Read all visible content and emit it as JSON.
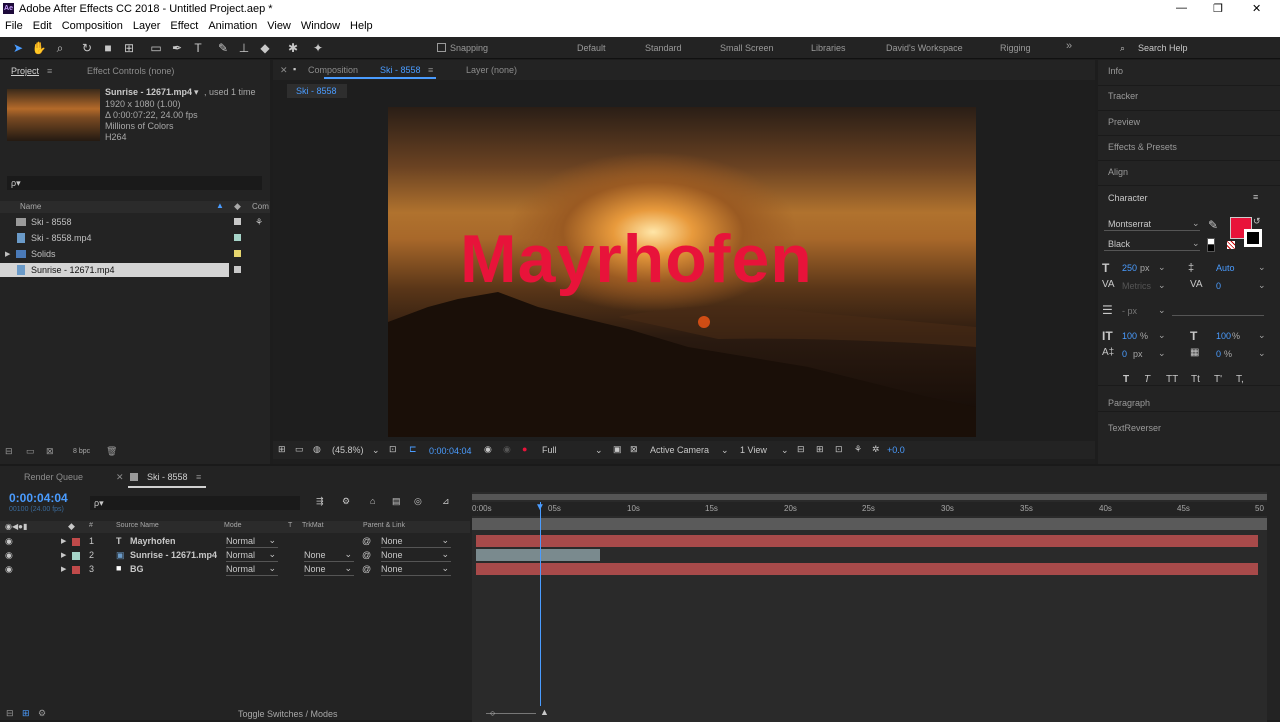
{
  "app": {
    "title": "Adobe After Effects CC 2018 - Untitled Project.aep *",
    "icon": "Ae"
  },
  "window_controls": {
    "minimize": "—",
    "maximize": "❐",
    "close": "✕"
  },
  "menu": [
    "File",
    "Edit",
    "Composition",
    "Layer",
    "Effect",
    "Animation",
    "View",
    "Window",
    "Help"
  ],
  "toolbar": {
    "snapping": "Snapping",
    "workspaces": [
      "Default",
      "Standard",
      "Small Screen",
      "Libraries",
      "David's Workspace",
      "Rigging"
    ],
    "more": "»",
    "search": "Search Help"
  },
  "project": {
    "tab": "Project",
    "tab2": "Effect Controls (none)",
    "asset": {
      "name": "Sunrise - 12671.mp4",
      "used": ", used 1 time",
      "res": "1920 x 1080 (1.00)",
      "dur": "Δ 0:00:07:22, 24.00 fps",
      "colors": "Millions of Colors",
      "codec": "H264"
    },
    "search_icon": "ρ▾",
    "col_name": "Name",
    "col_comment": "Com",
    "items": [
      {
        "name": "Ski - 8558",
        "color": "#c8c8c8"
      },
      {
        "name": "Ski - 8558.mp4",
        "color": "#a6d4c8"
      },
      {
        "name": "Solids",
        "color": "#e6d66e"
      },
      {
        "name": "Sunrise - 12671.mp4",
        "color": "#c8c8c8"
      }
    ],
    "bpc": "8 bpc"
  },
  "comp": {
    "tab": "Composition",
    "comp_name": "Ski - 8558",
    "layer_tab": "Layer (none)",
    "sub_tab": "Ski - 8558",
    "text": "Mayrhofen",
    "text_color": "#e8133a",
    "bottom": {
      "zoom": "(45.8%)",
      "timecode": "0:00:04:04",
      "res": "Full",
      "camera": "Active Camera",
      "view": "1 View",
      "exposure": "+0.0"
    }
  },
  "right": {
    "tabs": [
      "Info",
      "Tracker",
      "Preview",
      "Effects & Presets",
      "Align"
    ],
    "character": "Character",
    "font": "Montserrat",
    "style": "Black",
    "size": "250",
    "size_unit": "px",
    "leading": "Auto",
    "kerning": "Metrics",
    "tracking": "0",
    "stroke_unit": "- px",
    "vscale": "100",
    "hscale": "100",
    "pct": "%",
    "baseline": "0",
    "baseline_unit": "px",
    "tsume": "0",
    "tsume_unit": "%",
    "styles": [
      "T",
      "T",
      "TT",
      "Tt",
      "T'",
      "T,"
    ],
    "paragraph": "Paragraph",
    "textreverser": "TextReverser",
    "fill_color": "#e8133a"
  },
  "timeline": {
    "render_tab": "Render Queue",
    "comp_tab": "Ski - 8558",
    "timecode": "0:00:04:04",
    "frames": "00100 (24.00 fps)",
    "cols": {
      "hash": "#",
      "source": "Source Name",
      "mode": "Mode",
      "t": "T",
      "trk": "TrkMat",
      "parent": "Parent & Link"
    },
    "layers": [
      {
        "num": "1",
        "name": "Mayrhofen",
        "type": "T",
        "mode": "Normal",
        "trk": "",
        "parent": "None",
        "label": "#c04a4a"
      },
      {
        "num": "2",
        "name": "Sunrise - 12671.mp4",
        "type": "▣",
        "mode": "Normal",
        "trk": "None",
        "parent": "None",
        "label": "#a6d4c8"
      },
      {
        "num": "3",
        "name": "BG",
        "type": "■",
        "mode": "Normal",
        "trk": "None",
        "parent": "None",
        "label": "#c04a4a"
      }
    ],
    "ruler": [
      "0:00s",
      "05s",
      "10s",
      "15s",
      "20s",
      "25s",
      "30s",
      "35s",
      "40s",
      "45s",
      "50"
    ],
    "toggle": "Toggle Switches / Modes"
  }
}
